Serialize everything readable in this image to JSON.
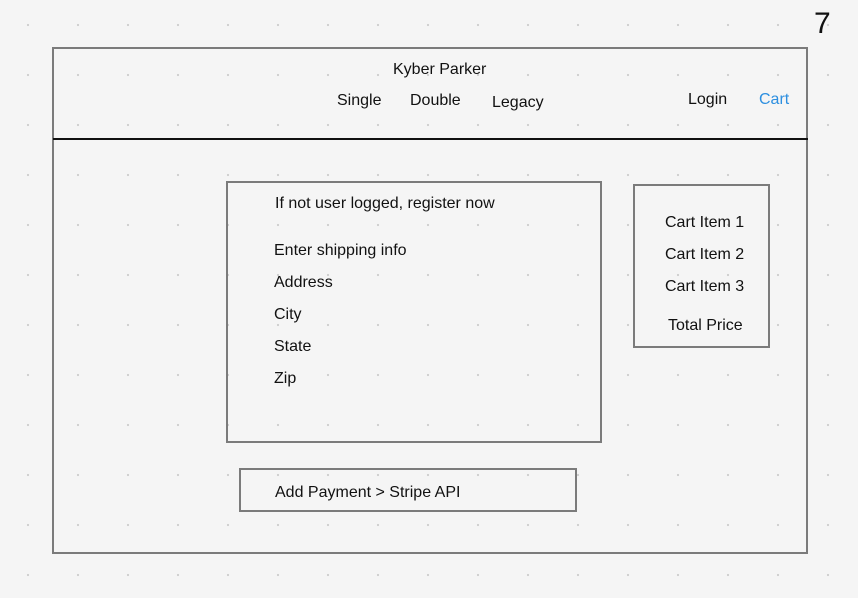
{
  "page_number": "7",
  "header": {
    "site_title": "Kyber Parker",
    "nav": {
      "single": "Single",
      "double": "Double",
      "legacy": "Legacy",
      "login": "Login",
      "cart": "Cart"
    }
  },
  "checkout": {
    "register_note": "If not user logged, register now",
    "shipping_heading": "Enter shipping info",
    "fields": {
      "address": "Address",
      "city": "City",
      "state": "State",
      "zip": "Zip"
    }
  },
  "cart_summary": {
    "items": [
      "Cart Item 1",
      "Cart Item 2",
      "Cart Item 3"
    ],
    "total_label": "Total Price"
  },
  "payment": {
    "label": "Add Payment > Stripe API"
  },
  "colors": {
    "cart_link": "#2d8fe0",
    "frame_border": "#7b7b7b",
    "header_rule": "#111111"
  }
}
